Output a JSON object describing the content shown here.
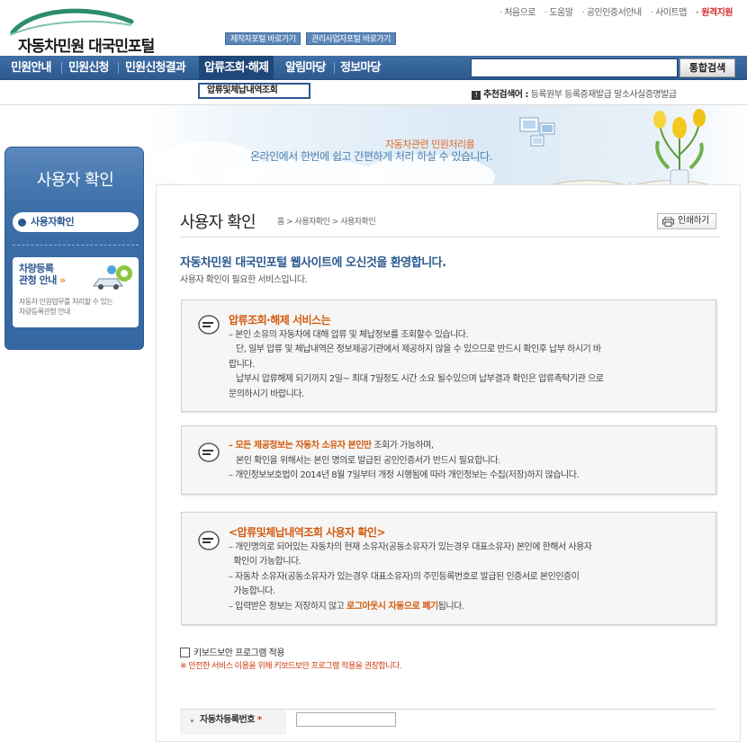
{
  "header": {
    "logo_text": "자동차민원 대국민포털",
    "shortcuts": [
      "제작자포털 바로가기",
      "관리사업자포털 바로가기"
    ],
    "util_links": [
      "처음으로",
      "도움말",
      "공인인증서안내",
      "사이트맵",
      "원격지원"
    ]
  },
  "gnb": {
    "items": [
      "민원안내",
      "민원신청",
      "민원신청결과",
      "압류조회·해제",
      "알림마당",
      "정보마당"
    ],
    "active_index": 3,
    "search_placeholder": "",
    "search_button": "통합검색",
    "submenu_item": "압류및체납내역조회",
    "recommend_label": "추천검색어 :",
    "recommend_terms": "등록원부   등록증재발급   말소사실증명발급"
  },
  "banner": {
    "line1": "자동차관련 민원처리를",
    "line2": "온라인에서 한번에 쉽고 간편하게 처리 하실 수 있습니다."
  },
  "sidebar": {
    "title": "사용자 확인",
    "item": "사용자확인",
    "promo_title_1": "차량등록",
    "promo_title_2": "관청 안내",
    "promo_arrow": "»",
    "promo_desc_1": "자동차 민원업무를 처리할 수 있는",
    "promo_desc_2": "차량등록관청 안내"
  },
  "main": {
    "title": "사용자 확인",
    "breadcrumb": "홈 > 사용자확인 > 사용자확인",
    "print_label": "인쇄하기",
    "welcome": "자동차민원 대국민포털 웹사이트에 오신것을 환영합니다.",
    "welcome_sub": "사용자 확인이 필요한 서비스입니다.",
    "notice1": {
      "heading": "압류조회·해제 서비스는",
      "line1": "– 본인 소유의 자동차에 대해 압류 및 체납정보를 조회할수 있습니다.",
      "line2": "   단, 일부 압류 및 체납내역은 정보제공기관에서 제공하지 않을 수 있으므로 반드시 확인후 납부 하시기 바",
      "line3": "랍니다.",
      "line4": "   납부시 압류해제 되기까지 2일~ 최대 7일정도 시간 소요 될수있으며 납부결과 확인은 압류촉탁기관 으로",
      "line5": "문의하시기 바랍니다."
    },
    "notice2": {
      "line1_a": "– 모든 제공정보는 자동차 소유자 본인만",
      "line1_b": " 조회가 가능하며,",
      "line2": "   본인 확인을 위해서는 본인 명의로 발급된 공인인증서가 반드시 필요합니다.",
      "line3": "– 개인정보보호법이 2014년 8월 7일부터 개정 시행됨에 따라 개인정보는 수집(저장)하지 않습니다."
    },
    "notice3": {
      "heading": "<압류및체납내역조회 사용자 확인>",
      "line1": "– 개인명의로 되어있는 자동차의 현재 소유자(공동소유자가 있는경우 대표소유자) 본인에 한해서 사용자",
      "line2": "  확인이 가능합니다.",
      "line3": "– 자동차 소유자(공동소유자가 있는경우 대표소유자)의 주민등록번호로 발급된 인증서로 본인인증이",
      "line4": "  가능합니다.",
      "line5_a": "– 입력받은 정보는 저장하지 않고 ",
      "line5_b": "로그아웃시 자동으로 폐기",
      "line5_c": "됩니다."
    },
    "keyboard_label": "키보드보안 프로그램 적용",
    "keyboard_warn": "※ 안전한 서비스 이용을 위해 키보드보안 프로그램 적용을 권장합니다.",
    "form_label": "자동차등록번호",
    "form_required": "*",
    "form_value": ""
  }
}
